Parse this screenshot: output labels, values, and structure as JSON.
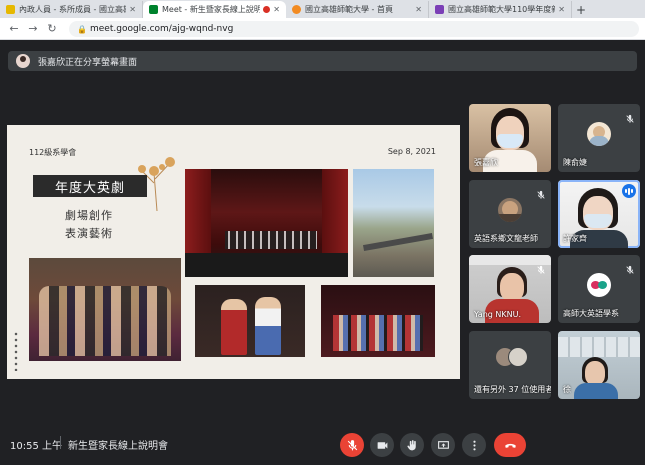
{
  "browser": {
    "tabs": [
      {
        "title": "內政人員 - 系所成員 - 國立高雄師範大學",
        "favicon_color": "#e6b800",
        "active": false
      },
      {
        "title": "Meet - 新生暨家長線上說明會",
        "favicon_color": "#00832d",
        "active": true
      },
      {
        "title": "國立高雄師範大學 - 首頁",
        "favicon_color": "#f28b22",
        "active": false
      },
      {
        "title": "國立高雄師範大學110學年度新生",
        "favicon_color": "#7b3fb6",
        "active": false
      }
    ],
    "new_tab_label": "+",
    "url": "meet.google.com/ajg-wqnd-nvg"
  },
  "banner": {
    "text": "張嘉欣正在分享螢幕畫面"
  },
  "slide": {
    "group": "112級系學會",
    "date": "Sep 8, 2021",
    "title": "年度大英劇",
    "sub1": "劇場創作",
    "sub2": "表演藝術"
  },
  "participants": [
    {
      "name": "張嘉欣",
      "muted": false,
      "kind": "video"
    },
    {
      "name": "陳俞婕",
      "muted": true,
      "kind": "avatar"
    },
    {
      "name": "英語系鄉文龍老師",
      "muted": true,
      "kind": "avatar"
    },
    {
      "name": "許家齊",
      "muted": false,
      "kind": "video",
      "speaking": true
    },
    {
      "name": "Yang NKNU.",
      "muted": true,
      "kind": "video"
    },
    {
      "name": "高師大英語學系",
      "muted": true,
      "kind": "avatar"
    },
    {
      "name": "還有另外 37 位使用者",
      "muted": false,
      "kind": "more"
    },
    {
      "name": "徐",
      "muted": true,
      "kind": "video"
    }
  ],
  "bottom": {
    "time": "10:55 上午",
    "meeting_name": "新生暨家長線上說明會"
  },
  "colors": {
    "meet_bg": "#202124",
    "tile_bg": "#3c4043",
    "end_call_red": "#ea4335",
    "speaking_blue": "#8ab4f8"
  },
  "icons": {
    "mic": "mic-off-icon",
    "camera": "camera-icon",
    "raise_hand": "raise-hand-icon",
    "present": "present-screen-icon",
    "more": "more-vert-icon",
    "end_call": "end-call-icon"
  }
}
